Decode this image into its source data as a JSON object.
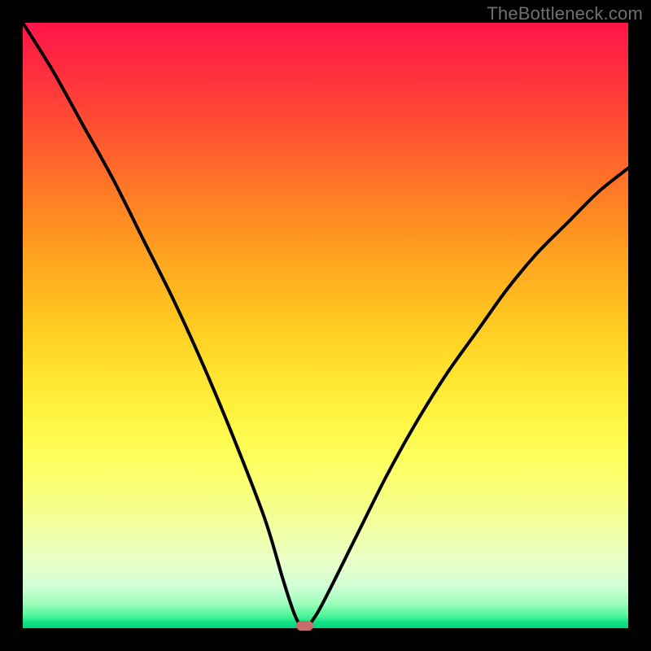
{
  "watermark": "TheBottleneck.com",
  "colors": {
    "frame": "#000000",
    "curve": "#000000",
    "marker": "#c76b6b"
  },
  "chart_data": {
    "type": "line",
    "title": "",
    "xlabel": "",
    "ylabel": "",
    "xlim": [
      0,
      100
    ],
    "ylim": [
      0,
      100
    ],
    "grid": false,
    "series": [
      {
        "name": "bottleneck-curve",
        "x": [
          0,
          5,
          10,
          15,
          20,
          25,
          30,
          35,
          40,
          43,
          45,
          46.5,
          48,
          50,
          55,
          60,
          65,
          70,
          75,
          80,
          85,
          90,
          95,
          100
        ],
        "values": [
          100,
          92,
          83,
          74,
          64,
          54,
          43,
          31,
          18,
          8,
          2,
          0,
          1.5,
          5,
          15,
          25,
          34,
          42,
          49,
          56,
          62,
          67,
          72,
          76
        ]
      }
    ],
    "marker": {
      "x": 46.5,
      "y": 0
    },
    "background_gradient_stops": [
      {
        "pos": 0.0,
        "color": "#ff154a"
      },
      {
        "pos": 0.25,
        "color": "#ff7a26"
      },
      {
        "pos": 0.55,
        "color": "#ffde2a"
      },
      {
        "pos": 0.8,
        "color": "#f4ff8e"
      },
      {
        "pos": 0.95,
        "color": "#b5ffc6"
      },
      {
        "pos": 1.0,
        "color": "#00d57b"
      }
    ]
  }
}
